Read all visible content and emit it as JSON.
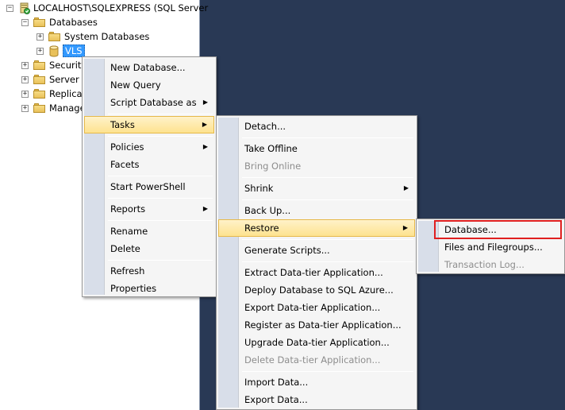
{
  "tree": {
    "server_label": "LOCALHOST\\SQLEXPRESS (SQL Server",
    "databases_label": "Databases",
    "system_databases_label": "System Databases",
    "selected_db_label": "VLS",
    "security_label": "Security",
    "server_objects_label": "Server O",
    "replication_label": "Replicati",
    "management_label": "Manage",
    "expand_glyph": "+",
    "collapse_glyph": "−"
  },
  "db_menu": {
    "new_database": "New Database...",
    "new_query": "New Query",
    "script_database_as": "Script Database as",
    "tasks": "Tasks",
    "policies": "Policies",
    "facets": "Facets",
    "start_powershell": "Start PowerShell",
    "reports": "Reports",
    "rename": "Rename",
    "delete": "Delete",
    "refresh": "Refresh",
    "properties": "Properties"
  },
  "tasks_menu": {
    "detach": "Detach...",
    "take_offline": "Take Offline",
    "bring_online": "Bring Online",
    "shrink": "Shrink",
    "back_up": "Back Up...",
    "restore": "Restore",
    "generate_scripts": "Generate Scripts...",
    "extract_data_tier": "Extract Data-tier Application...",
    "deploy_azure": "Deploy Database to SQL Azure...",
    "export_data_tier": "Export Data-tier Application...",
    "register_data_tier": "Register as Data-tier Application...",
    "upgrade_data_tier": "Upgrade Data-tier Application...",
    "delete_data_tier": "Delete Data-tier Application...",
    "import_data": "Import Data...",
    "export_data": "Export Data..."
  },
  "restore_menu": {
    "database": "Database...",
    "files_and_filegroups": "Files and Filegroups...",
    "transaction_log": "Transaction Log..."
  },
  "submenu_arrow": "▶",
  "colors": {
    "background": "#293955",
    "menu_background": "#f5f5f5",
    "gutter": "#d8dee9",
    "hover": "#fde28f",
    "selection": "#3399ff",
    "highlight_box": "#e02020"
  }
}
